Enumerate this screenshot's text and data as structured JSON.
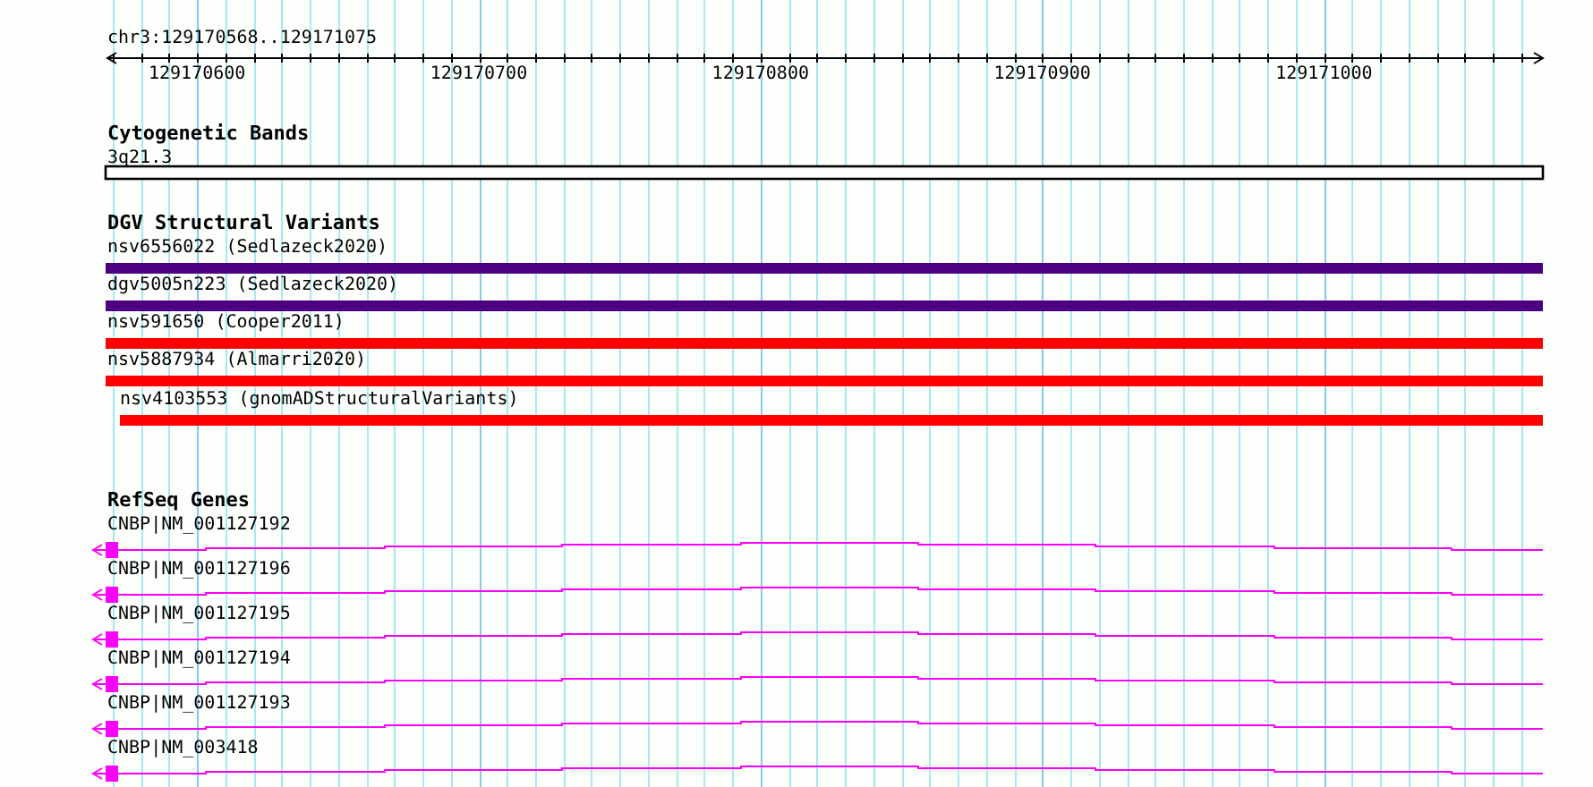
{
  "ruler": {
    "label": "chr3:129170568..129171075",
    "ticks": [
      "129170600",
      "129170700",
      "129170800",
      "129170900",
      "129171000"
    ]
  },
  "tracks": [
    {
      "kind": "bands",
      "title": "Cytogenetic Bands",
      "items": [
        {
          "name": "3q21.3"
        }
      ]
    },
    {
      "kind": "variants",
      "title": "DGV Structural Variants",
      "items": [
        {
          "name": "nsv6556022 (Sedlazeck2020)",
          "color": "#4b0082"
        },
        {
          "name": "dgv5005n223 (Sedlazeck2020)",
          "color": "#4b0082"
        },
        {
          "name": "nsv591650 (Cooper2011)",
          "color": "#ff0000"
        },
        {
          "name": "nsv5887934 (Almarri2020)",
          "color": "#ff0000"
        },
        {
          "name": "nsv4103553 (gnomADStructuralVariants)",
          "color": "#ff0000"
        }
      ]
    },
    {
      "kind": "genes",
      "title": "RefSeq Genes",
      "items": [
        {
          "name": "CNBP|NM_001127192"
        },
        {
          "name": "CNBP|NM_001127196"
        },
        {
          "name": "CNBP|NM_001127195"
        },
        {
          "name": "CNBP|NM_001127194"
        },
        {
          "name": "CNBP|NM_001127193"
        },
        {
          "name": "CNBP|NM_003418"
        }
      ]
    }
  ]
}
